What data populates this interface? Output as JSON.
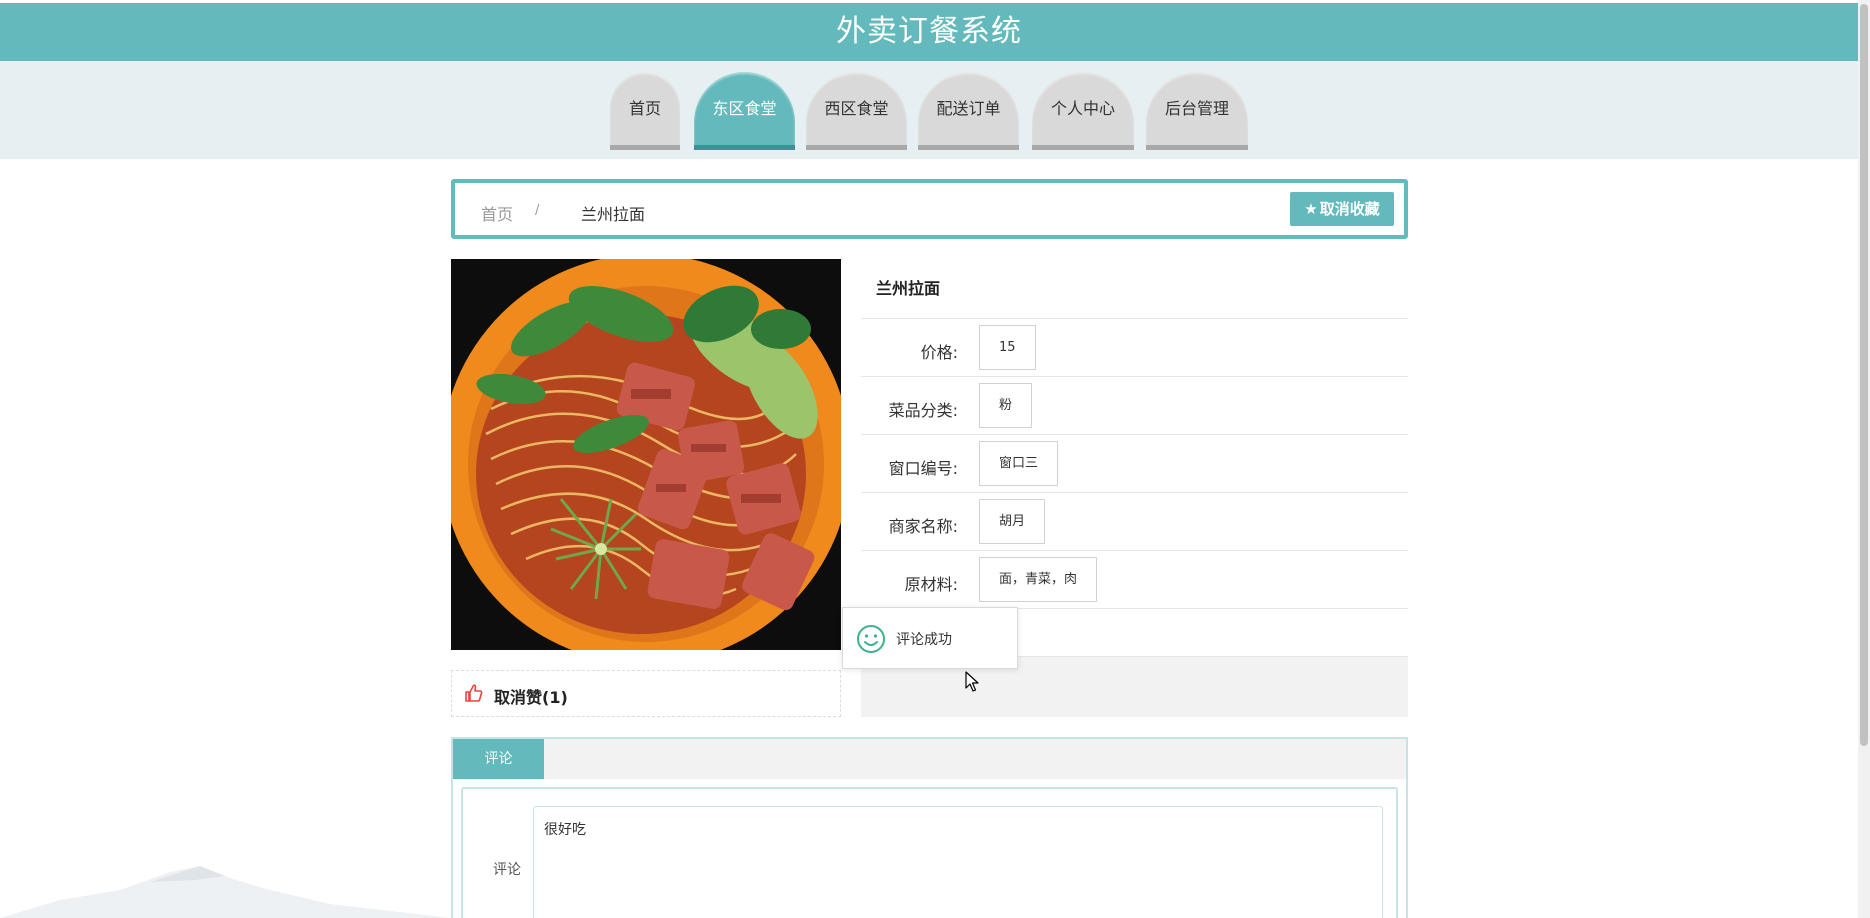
{
  "header": {
    "title": "外卖订餐系统"
  },
  "nav": {
    "tabs": [
      {
        "label": "首页"
      },
      {
        "label": "东区食堂",
        "active": true
      },
      {
        "label": "西区食堂"
      },
      {
        "label": "配送订单"
      },
      {
        "label": "个人中心"
      },
      {
        "label": "后台管理"
      }
    ]
  },
  "breadcrumb": {
    "home": "首页",
    "separator": "/",
    "current": "兰州拉面"
  },
  "favorite_button": {
    "icon": "star-icon",
    "label": "取消收藏"
  },
  "like": {
    "icon": "thumbs-up-icon",
    "label": "取消赞(1)"
  },
  "detail": {
    "title": "兰州拉面",
    "fields": [
      {
        "label": "价格:",
        "value": "15"
      },
      {
        "label": "菜品分类:",
        "value": "粉"
      },
      {
        "label": "窗口编号:",
        "value": "窗口三"
      },
      {
        "label": "商家名称:",
        "value": "胡月"
      },
      {
        "label": "原材料:",
        "value": "面，青菜，肉"
      }
    ]
  },
  "toast": {
    "icon": "smile-icon",
    "message": "评论成功"
  },
  "comments": {
    "tab_label": "评论",
    "field_label": "评论",
    "value": "很好吃"
  },
  "colors": {
    "accent": "#63b9bb",
    "nav_band": "#e6f0f2",
    "tab_inactive": "#d9d9d9"
  }
}
